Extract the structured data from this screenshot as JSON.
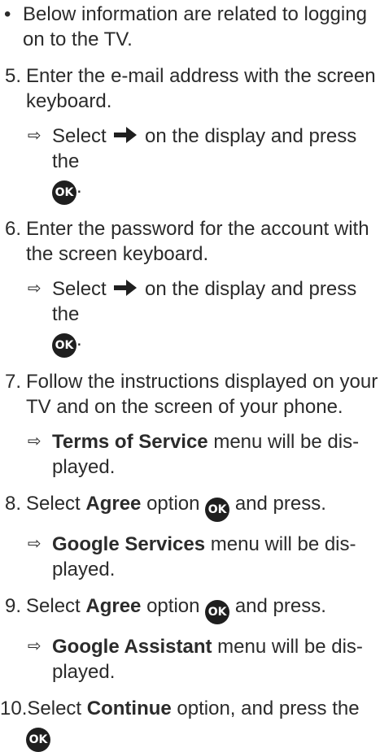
{
  "intro": {
    "bullet": "•",
    "text": "Below information are related to logging on to the TV."
  },
  "steps": [
    {
      "num": "5.",
      "text": "Enter the e-mail address with the screen keyboard.",
      "result": {
        "arrow": "⇨",
        "before": "Select",
        "after": "on the display and press the",
        "end": "."
      }
    },
    {
      "num": "6.",
      "text": "Enter the password for the account with the screen keyboard.",
      "result": {
        "arrow": "⇨",
        "before": "Select",
        "after": "on the display and press the",
        "end": "."
      }
    },
    {
      "num": "7.",
      "text": "Follow the instructions displayed on your TV and on the screen of your phone.",
      "result": {
        "arrow": "⇨",
        "bold": "Terms of Service",
        "after": "menu will be dis-played."
      }
    },
    {
      "num": "8.",
      "pre": "Select",
      "bold": "Agree",
      "mid": "option",
      "post": "and press.",
      "result": {
        "arrow": "⇨",
        "bold": "Google Services",
        "after": "menu will be dis-played."
      }
    },
    {
      "num": "9.",
      "pre": "Select",
      "bold": "Agree",
      "mid": "option",
      "post": "and press.",
      "result": {
        "arrow": "⇨",
        "bold": "Google Assistant",
        "after": "menu will be dis-played."
      }
    },
    {
      "num": "10.",
      "pre": "Select",
      "bold": "Continue",
      "post": "option, and press the"
    }
  ],
  "icons": {
    "ok": "OK",
    "right_arrow": "right-arrow-icon",
    "ok_color": "#1f1f1f"
  }
}
